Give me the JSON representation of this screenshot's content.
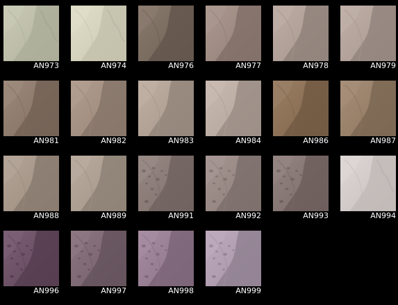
{
  "thumbnails": [
    {
      "label": "AN973",
      "color": "#c2c3ad",
      "style": "bright"
    },
    {
      "label": "AN974",
      "color": "#dcd9c2",
      "style": "bright"
    },
    {
      "label": "AN976",
      "color": "#7b6a5d",
      "style": "normal"
    },
    {
      "label": "AN977",
      "color": "#a08b81",
      "style": "normal"
    },
    {
      "label": "AN978",
      "color": "#b4a399",
      "style": "normal"
    },
    {
      "label": "AN979",
      "color": "#b7a59c",
      "style": "normal"
    },
    {
      "label": "AN981",
      "color": "#8f7a6a",
      "style": "normal"
    },
    {
      "label": "AN982",
      "color": "#a79181",
      "style": "normal"
    },
    {
      "label": "AN983",
      "color": "#b7a598",
      "style": "normal"
    },
    {
      "label": "AN984",
      "color": "#c2b1a7",
      "style": "normal"
    },
    {
      "label": "AN986",
      "color": "#8c6f52",
      "style": "normal"
    },
    {
      "label": "AN987",
      "color": "#9a8067",
      "style": "normal"
    },
    {
      "label": "AN988",
      "color": "#aa998a",
      "style": "normal"
    },
    {
      "label": "AN989",
      "color": "#b0a293",
      "style": "normal"
    },
    {
      "label": "AN991",
      "color": "#8a7a75",
      "style": "textured"
    },
    {
      "label": "AN992",
      "color": "#9a8985",
      "style": "textured"
    },
    {
      "label": "AN993",
      "color": "#867572",
      "style": "textured"
    },
    {
      "label": "AN994",
      "color": "#d9d1cf",
      "style": "bright"
    },
    {
      "label": "AN996",
      "color": "#6a4c63",
      "style": "textured"
    },
    {
      "label": "AN997",
      "color": "#7e6672",
      "style": "textured"
    },
    {
      "label": "AN998",
      "color": "#9a7e95",
      "style": "textured"
    },
    {
      "label": "AN999",
      "color": "#b4a0b5",
      "style": "textured"
    }
  ]
}
